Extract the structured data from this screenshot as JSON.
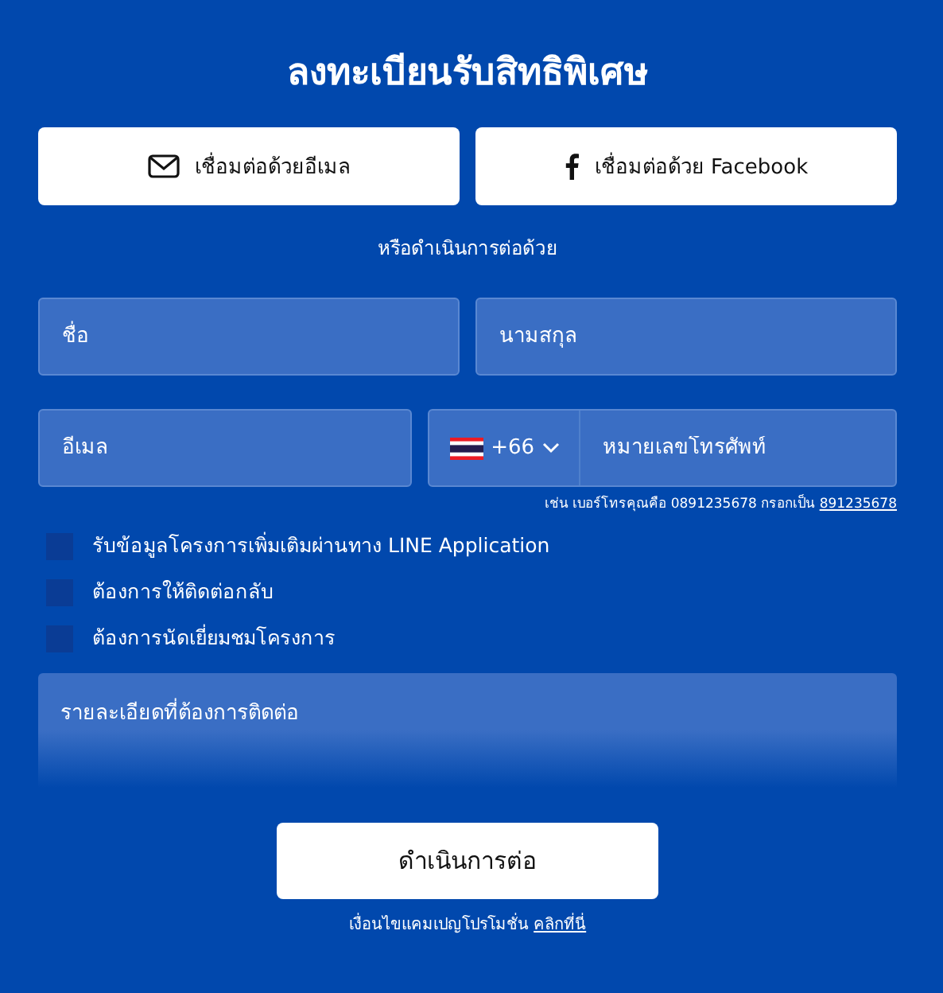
{
  "title": "ลงทะเบียนรับสิทธิพิเศษ",
  "social_buttons": [
    {
      "kind": "email",
      "label": "เชื่อมต่อด้วยอีเมล"
    },
    {
      "kind": "facebook",
      "label": "เชื่อมต่อด้วย Facebook"
    }
  ],
  "divider_text": "หรือดำเนินการต่อด้วย",
  "fields": [
    {
      "placeholder": "ชื่อ"
    },
    {
      "placeholder": "นามสกุล"
    },
    {
      "placeholder": "อีเมล"
    }
  ],
  "phone": {
    "country_code": "+66",
    "placeholder": "หมายเลขโทรศัพท์"
  },
  "phone_hint": {
    "text": "เช่น เบอร์โทรคุณคือ 0891235678 กรอกเป็น",
    "example": "891235678"
  },
  "checkboxes": [
    {
      "label": "รับข้อมูลโครงการเพิ่มเติมผ่านทาง LINE Application",
      "checked": false
    },
    {
      "label": "ต้องการให้ติดต่อกลับ",
      "checked": false
    },
    {
      "label": "ต้องการนัดเยี่ยมชมโครงการ",
      "checked": false
    }
  ],
  "details": {
    "placeholder": "รายละเอียดที่ต้องการติดต่อ"
  },
  "submit": "ดำเนินการต่อ",
  "footer": {
    "text": "เงื่อนไขแคมเปญโปรโมชั่น",
    "link": "คลิกที่นี่"
  }
}
